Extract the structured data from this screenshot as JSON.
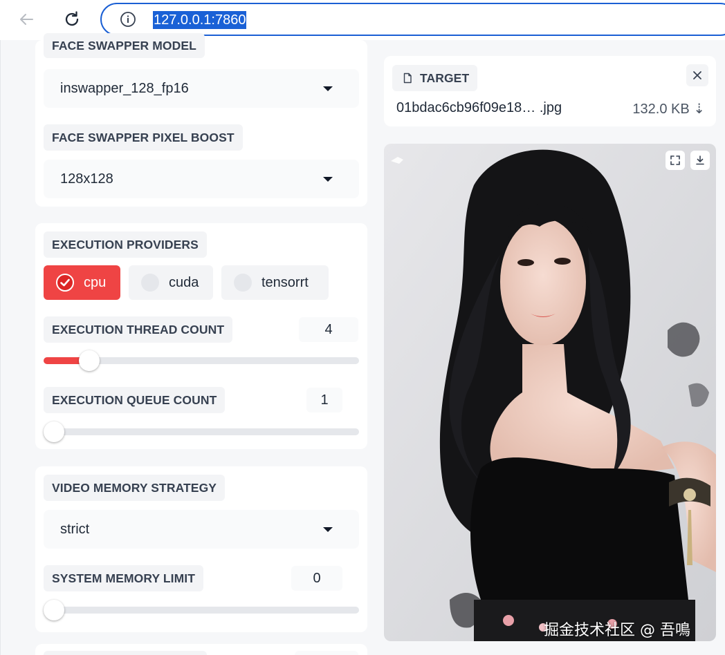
{
  "browser": {
    "url": "127.0.0.1:7860",
    "accent_color": "#1a5fd4"
  },
  "left": {
    "face_swapper_model": {
      "label": "FACE SWAPPER MODEL",
      "value": "inswapper_128_fp16"
    },
    "face_swapper_pixel_boost": {
      "label": "FACE SWAPPER PIXEL BOOST",
      "value": "128x128"
    },
    "execution_providers": {
      "label": "EXECUTION PROVIDERS",
      "options": [
        {
          "label": "cpu",
          "checked": true
        },
        {
          "label": "cuda",
          "checked": false
        },
        {
          "label": "tensorrt",
          "checked": false
        }
      ]
    },
    "execution_thread_count": {
      "label": "EXECUTION THREAD COUNT",
      "value": "4",
      "slider_fraction": 0.12
    },
    "execution_queue_count": {
      "label": "EXECUTION QUEUE COUNT",
      "value": "1",
      "slider_fraction": 0.0
    },
    "video_memory_strategy": {
      "label": "VIDEO MEMORY STRATEGY",
      "value": "strict"
    },
    "system_memory_limit": {
      "label": "SYSTEM MEMORY LIMIT",
      "value": "0",
      "slider_fraction": 0.0
    }
  },
  "right": {
    "target": {
      "label": "TARGET",
      "file_name": "01bdac6cb96f09e18… .jpg",
      "file_size": "132.0 KB ⇣"
    },
    "watermark": "掘金技术社区 @ 吾鳴"
  },
  "icons": {
    "back": "back-arrow-icon",
    "reload": "reload-icon",
    "info": "info-icon",
    "file": "file-icon",
    "close": "close-icon",
    "fullscreen": "fullscreen-icon",
    "download": "download-icon",
    "checkmark": "checkmark-icon",
    "dropdown": "chevron-down-icon"
  },
  "colors": {
    "primary_red": "#ef4444",
    "card_bg": "#ffffff",
    "page_bg": "#f6f7f9"
  }
}
